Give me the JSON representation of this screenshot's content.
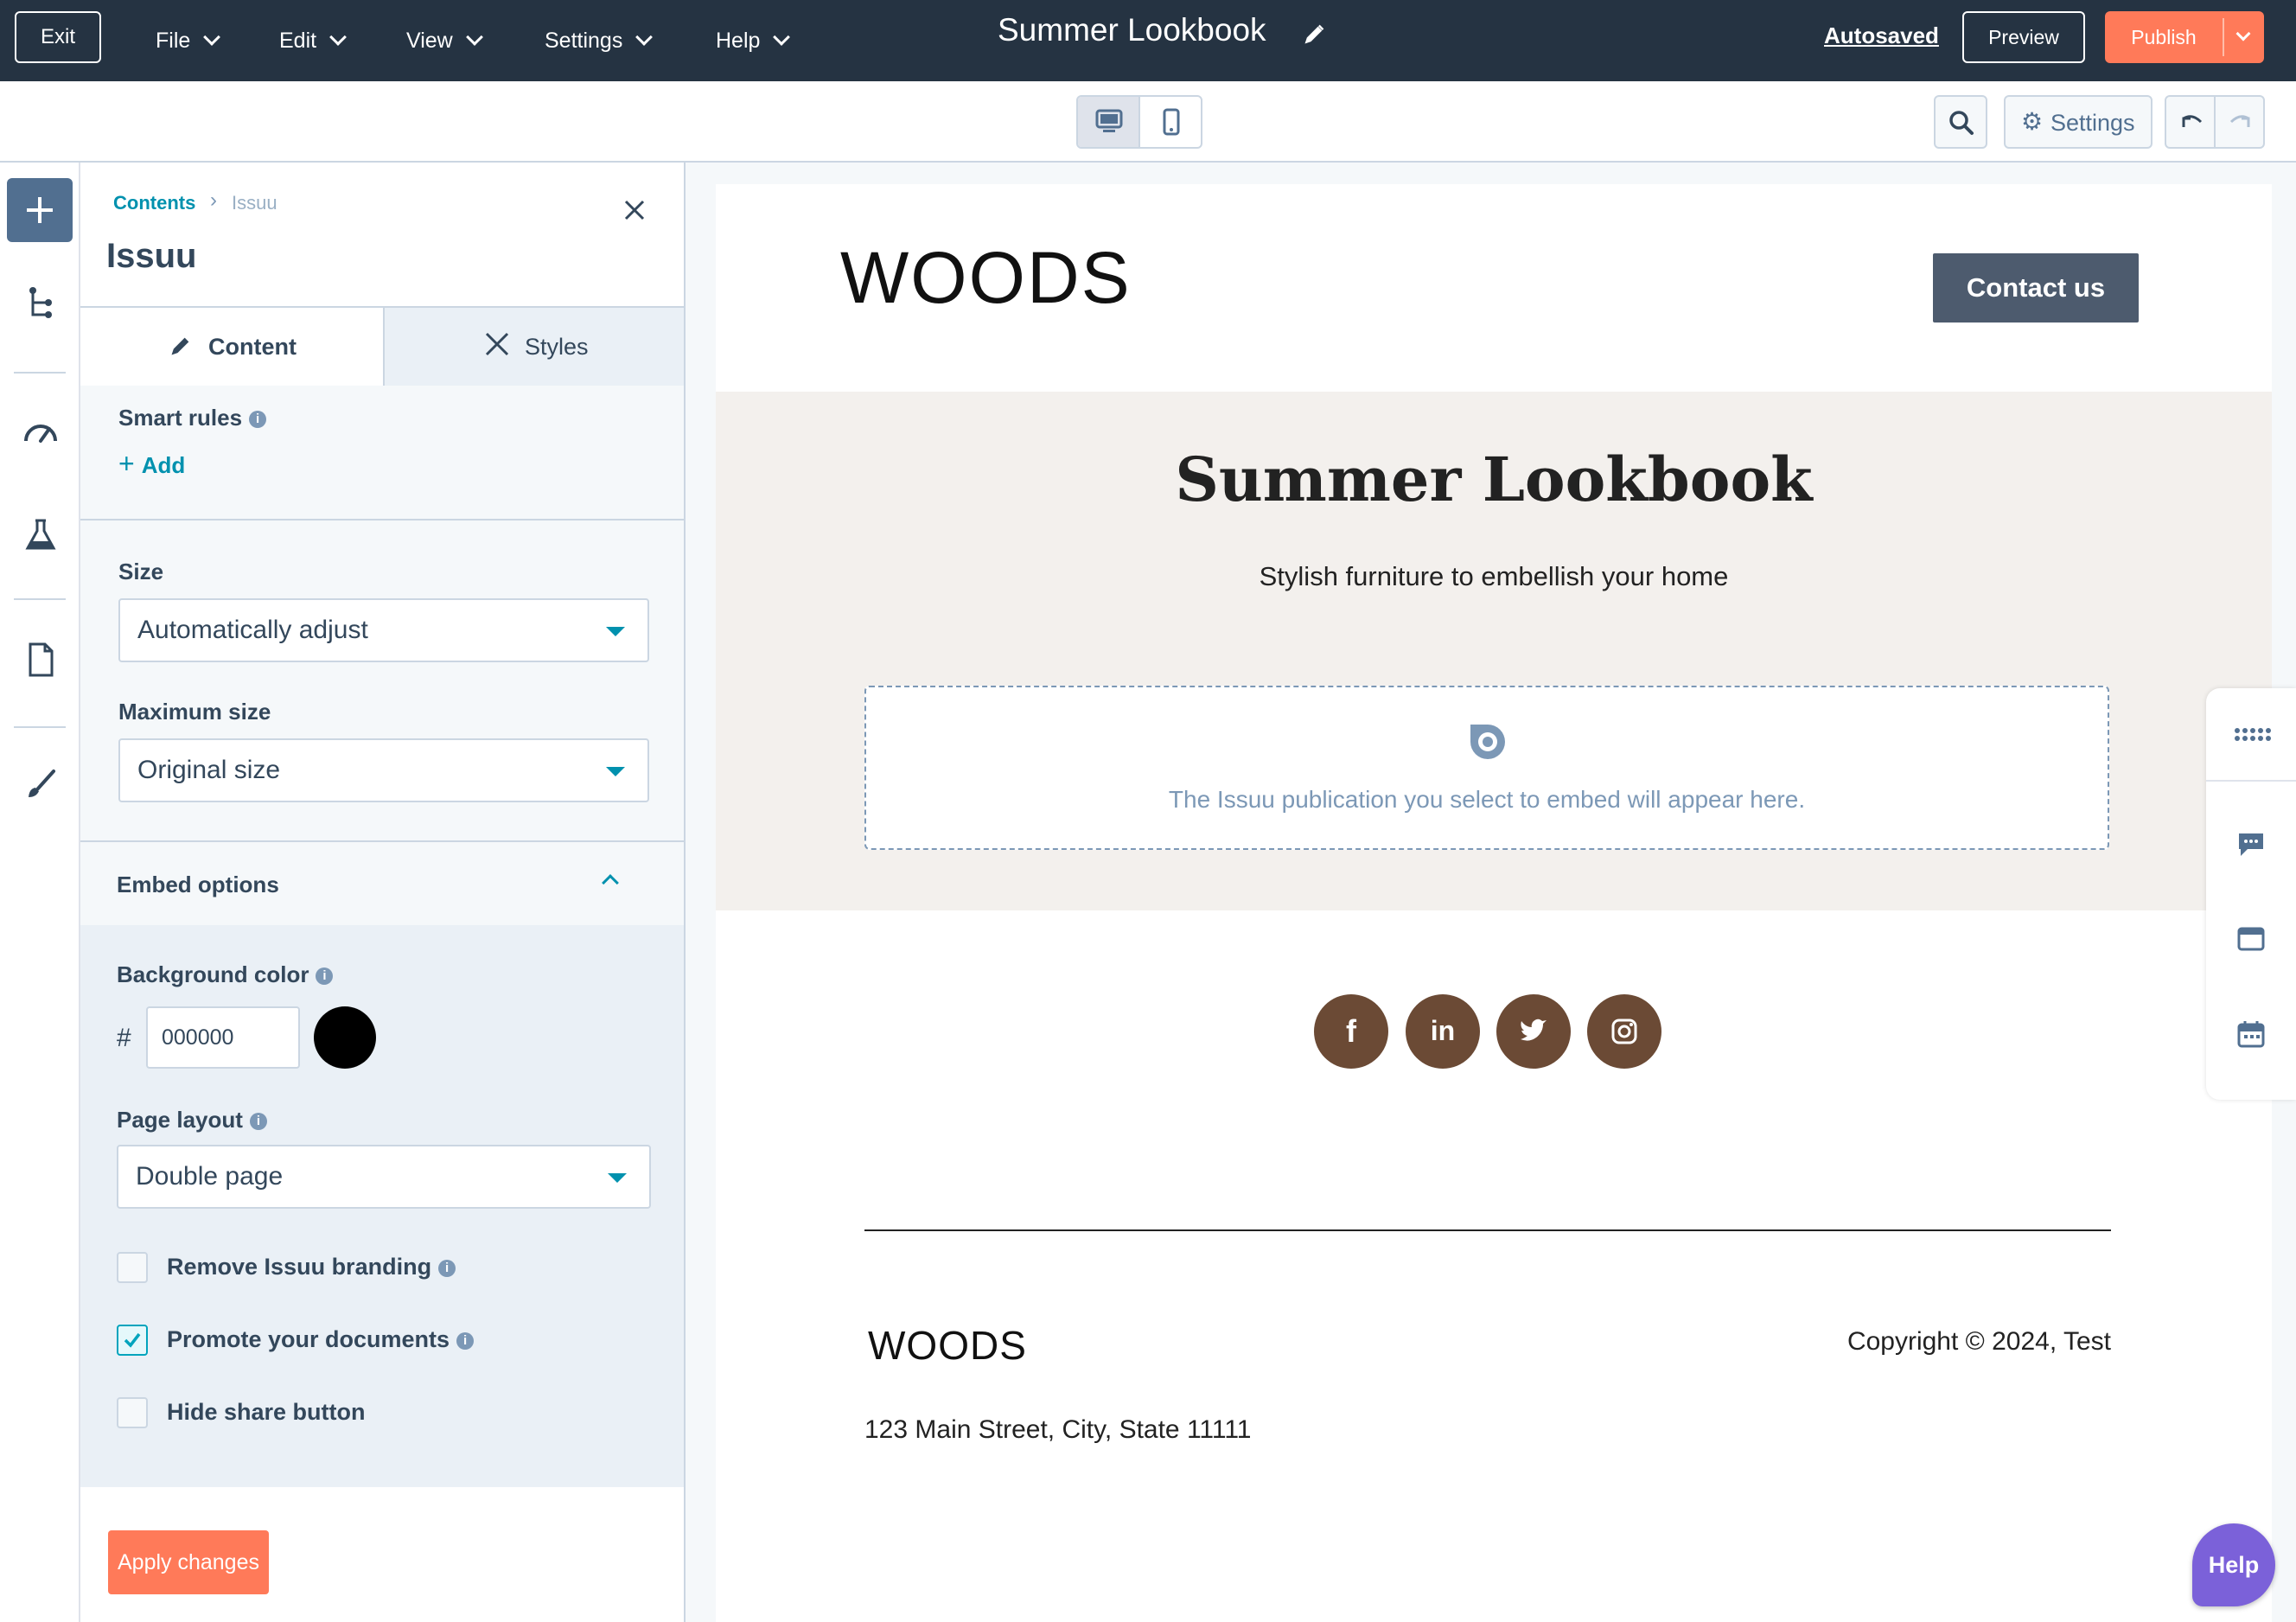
{
  "topbar": {
    "exit": "Exit",
    "menus": [
      "File",
      "Edit",
      "View",
      "Settings",
      "Help"
    ],
    "title": "Summer Lookbook",
    "autosaved": "Autosaved",
    "preview": "Preview",
    "publish": "Publish"
  },
  "toolbar": {
    "settings": "Settings"
  },
  "panel": {
    "breadcrumb_root": "Contents",
    "breadcrumb_current": "Issuu",
    "title": "Issuu",
    "tab_content": "Content",
    "tab_styles": "Styles",
    "smart_rules": "Smart rules",
    "add": "Add",
    "size_label": "Size",
    "size_value": "Automatically adjust",
    "max_label": "Maximum size",
    "max_value": "Original size",
    "embed_options": "Embed options",
    "bg_label": "Background color",
    "hash": "#",
    "bg_value": "000000",
    "bg_color": "#000000",
    "layout_label": "Page layout",
    "layout_value": "Double page",
    "remove_branding": "Remove Issuu branding",
    "promote_docs": "Promote your documents",
    "hide_share": "Hide share button",
    "apply": "Apply changes",
    "checkboxes": {
      "remove_branding": false,
      "promote_docs": true,
      "hide_share": false
    }
  },
  "page": {
    "logo": "WOODS",
    "contact": "Contact us",
    "heading": "Summer Lookbook",
    "subheading": "Stylish furniture to embellish your home",
    "embed_placeholder": "The Issuu publication you select to embed will appear here.",
    "social": [
      "facebook-icon",
      "linkedin-icon",
      "twitter-icon",
      "instagram-icon"
    ],
    "footer_logo": "WOODS",
    "copyright": "Copyright © 2024, Test",
    "address": "123 Main Street, City, State 11111"
  },
  "help": "Help",
  "colors": {
    "accent": "#ff7a59",
    "brand_dark": "#253342",
    "social": "#6b4a35",
    "teal": "#0091ae"
  }
}
